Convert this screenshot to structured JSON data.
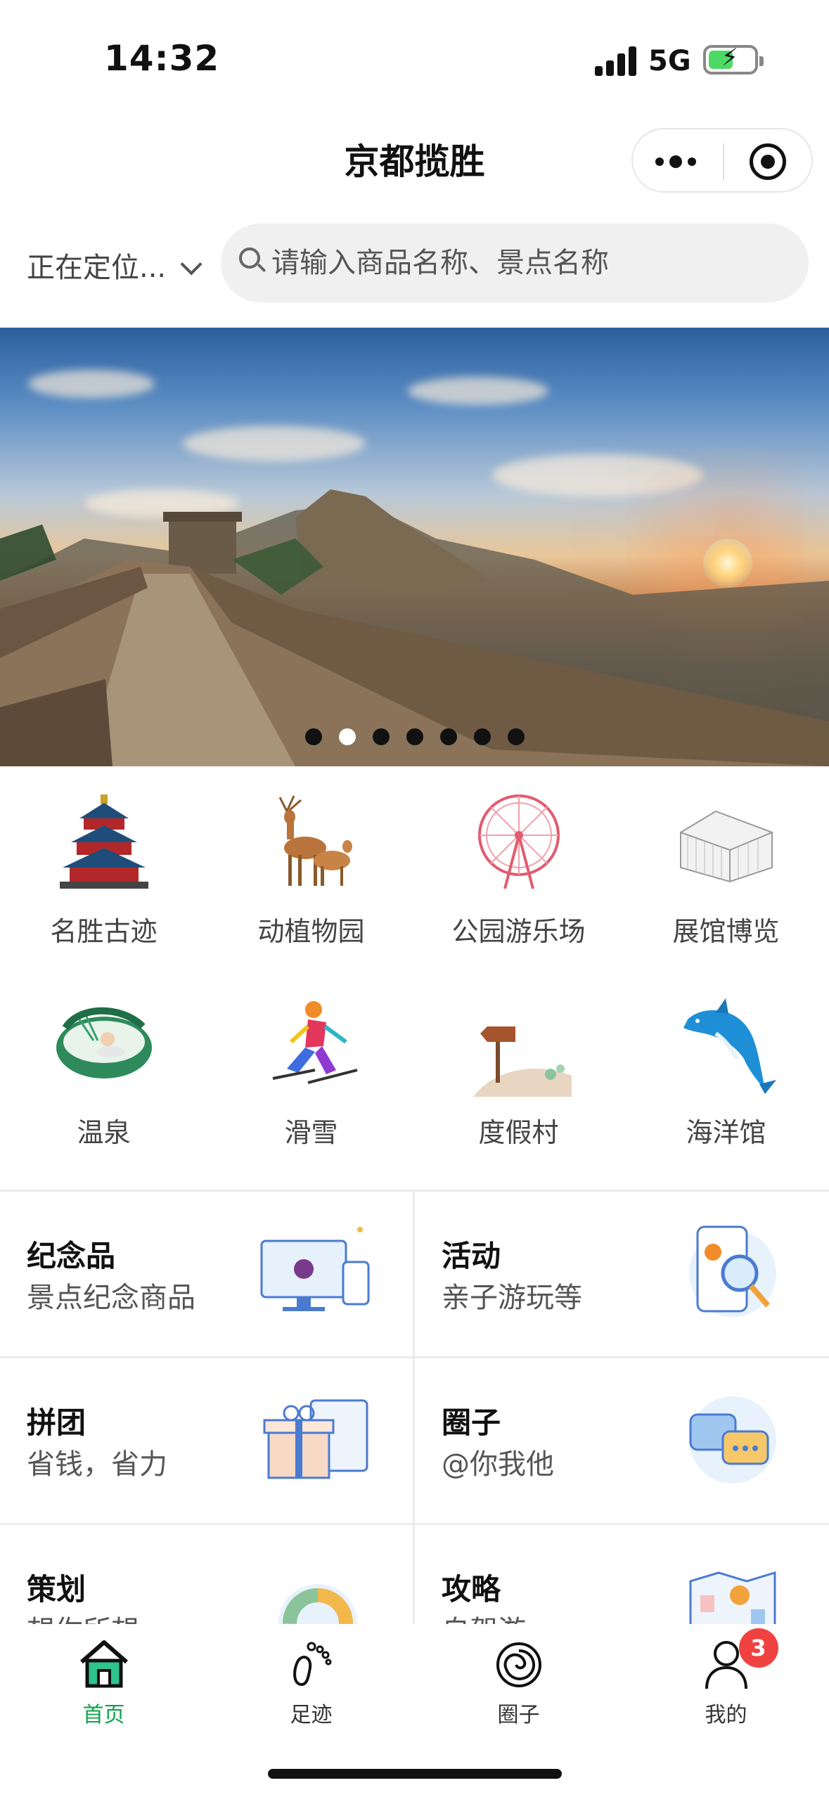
{
  "status_bar": {
    "time": "14:32",
    "network": "5G"
  },
  "nav": {
    "title": "京都揽胜",
    "more_icon": "more-dots-icon",
    "close_icon": "target-circle-icon"
  },
  "location": {
    "label": "正在定位..."
  },
  "search": {
    "placeholder": "请输入商品名称、景点名称"
  },
  "banner": {
    "slide_count": 7,
    "active_index": 1,
    "subject": "great-wall-sunset"
  },
  "categories": [
    {
      "label": "名胜古迹",
      "icon": "temple-of-heaven-icon"
    },
    {
      "label": "动植物园",
      "icon": "deer-icon"
    },
    {
      "label": "公园游乐场",
      "icon": "ferris-wheel-icon"
    },
    {
      "label": "展馆博览",
      "icon": "exhibition-hall-icon"
    },
    {
      "label": "温泉",
      "icon": "hot-spring-icon"
    },
    {
      "label": "滑雪",
      "icon": "skier-icon"
    },
    {
      "label": "度假村",
      "icon": "signpost-icon"
    },
    {
      "label": "海洋馆",
      "icon": "dolphin-icon"
    }
  ],
  "features": [
    {
      "title": "纪念品",
      "subtitle": "景点纪念商品",
      "icon": "souvenir-monitor-icon"
    },
    {
      "title": "活动",
      "subtitle": "亲子游玩等",
      "icon": "phone-search-icon"
    },
    {
      "title": "拼团",
      "subtitle": "省钱，省力",
      "icon": "gift-box-icon"
    },
    {
      "title": "圈子",
      "subtitle": "@你我他",
      "icon": "chat-bubbles-icon"
    },
    {
      "title": "策划",
      "subtitle": "想你所想",
      "icon": "donut-chart-icon"
    },
    {
      "title": "攻略",
      "subtitle": "自驾游",
      "icon": "map-pin-icon"
    }
  ],
  "tabbar": {
    "items": [
      {
        "label": "首页",
        "icon": "home-icon",
        "active": true
      },
      {
        "label": "足迹",
        "icon": "footprint-icon",
        "active": false
      },
      {
        "label": "圈子",
        "icon": "spiral-circle-icon",
        "active": false
      },
      {
        "label": "我的",
        "icon": "user-icon",
        "active": false,
        "badge": "3"
      }
    ]
  },
  "colors": {
    "accent": "#11a24a",
    "badge": "#f04141",
    "search_bg": "#f0f0f0"
  }
}
